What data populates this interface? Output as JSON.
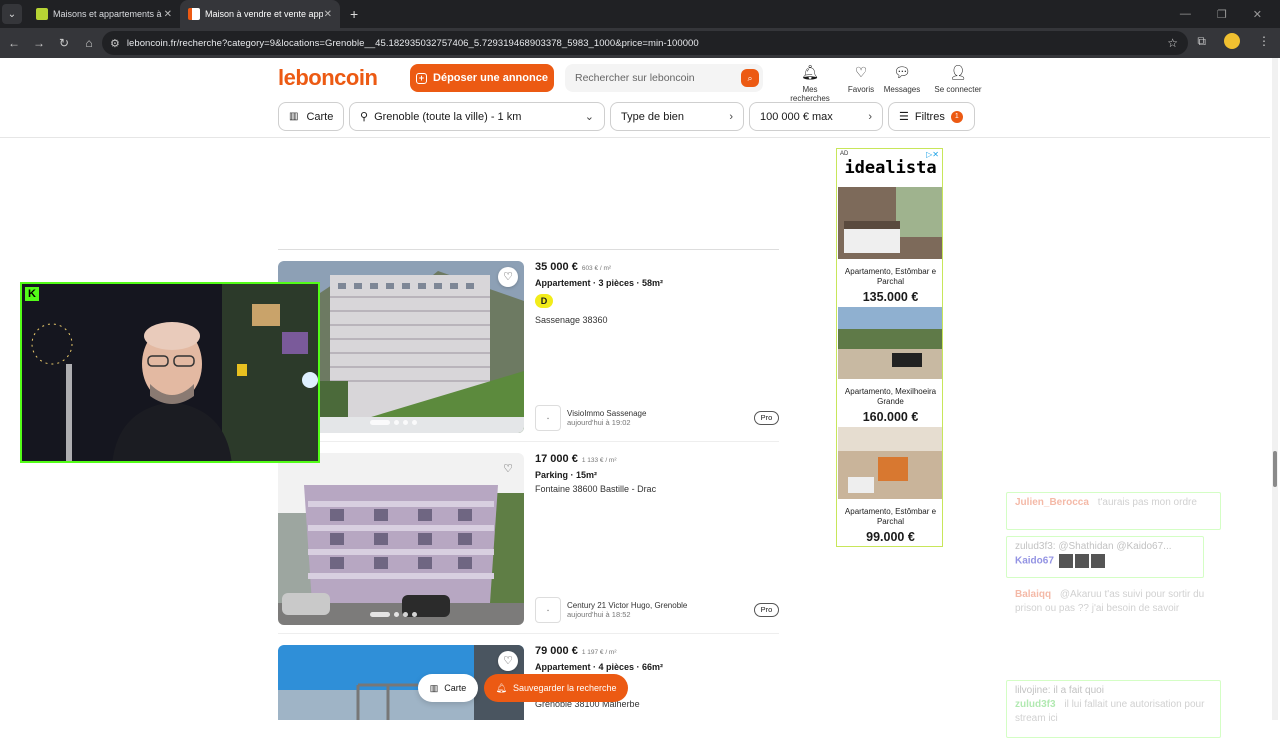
{
  "browser": {
    "tabs": [
      {
        "title": "Maisons et appartements à vendre",
        "active": false
      },
      {
        "title": "Maison à vendre et vente appartement",
        "active": true
      }
    ],
    "url": "leboncoin.fr/recherche?category=9&locations=Grenoble__45.182935032757406_5.729319468903378_5983_1000&price=min-100000"
  },
  "header": {
    "logo": "leboncoin",
    "post_button": "Déposer une annonce",
    "search_placeholder": "Rechercher sur leboncoin",
    "icons": [
      {
        "label": "Mes recherches",
        "icon": "bell-icon"
      },
      {
        "label": "Favoris",
        "icon": "heart-icon"
      },
      {
        "label": "Messages",
        "icon": "message-icon"
      },
      {
        "label": "Se connecter",
        "icon": "user-icon"
      }
    ]
  },
  "filters": {
    "map": "Carte",
    "location": "Grenoble (toute la ville) - 1 km",
    "type": "Type de bien",
    "price": "100 000 € max",
    "more": "Filtres",
    "count": "1"
  },
  "listings": [
    {
      "price": "35 000 €",
      "ppm": "603 € / m²",
      "type": "Appartement · 3 pièces · 58m²",
      "dpe": "D",
      "location": "Sassenage 38360",
      "seller": "VisioImmo Sassenage",
      "date": "aujourd'hui à 19:02",
      "pro": "Pro"
    },
    {
      "price": "17 000 €",
      "ppm": "1 133 € / m²",
      "type": "Parking · 15m²",
      "location": "Fontaine 38600 Bastille - Drac",
      "seller": "Century 21 Victor Hugo, Grenoble",
      "date": "aujourd'hui à 18:52",
      "pro": "Pro"
    },
    {
      "price": "79 000 €",
      "ppm": "1 197 € / m²",
      "type": "Appartement · 4 pièces · 66m²",
      "location": "Grenoble 38100 Malherbe"
    }
  ],
  "ad": {
    "label": "AD",
    "brand": "idealista",
    "items": [
      {
        "caption": "Apartamento, Estômbar e Parchal",
        "price": "135.000 €"
      },
      {
        "caption": "Apartamento, Mexilhoeira Grande",
        "price": "160.000 €"
      },
      {
        "caption": "Apartamento, Estômbar e Parchal",
        "price": "99.000 €"
      }
    ]
  },
  "chat": [
    {
      "user": "Julien_Berocca",
      "text": "t'aurais pas mon ordre"
    },
    {
      "reply": "zulud3f3: @Shathidan @Kaido67...",
      "user": "Kaido67",
      "text": ""
    },
    {
      "user": "Balaiqq",
      "text": "@Akaruu t'as suivi pour sortir du prison ou pas ?? j'ai besoin de savoir"
    },
    {
      "reply": "lilvojine: il a fait quoi",
      "user": "zulud3f3",
      "text": "il lui fallait une autorisation pour stream ici"
    }
  ],
  "floating": {
    "map": "Carte",
    "save": "Sauvegarder la recherche"
  }
}
